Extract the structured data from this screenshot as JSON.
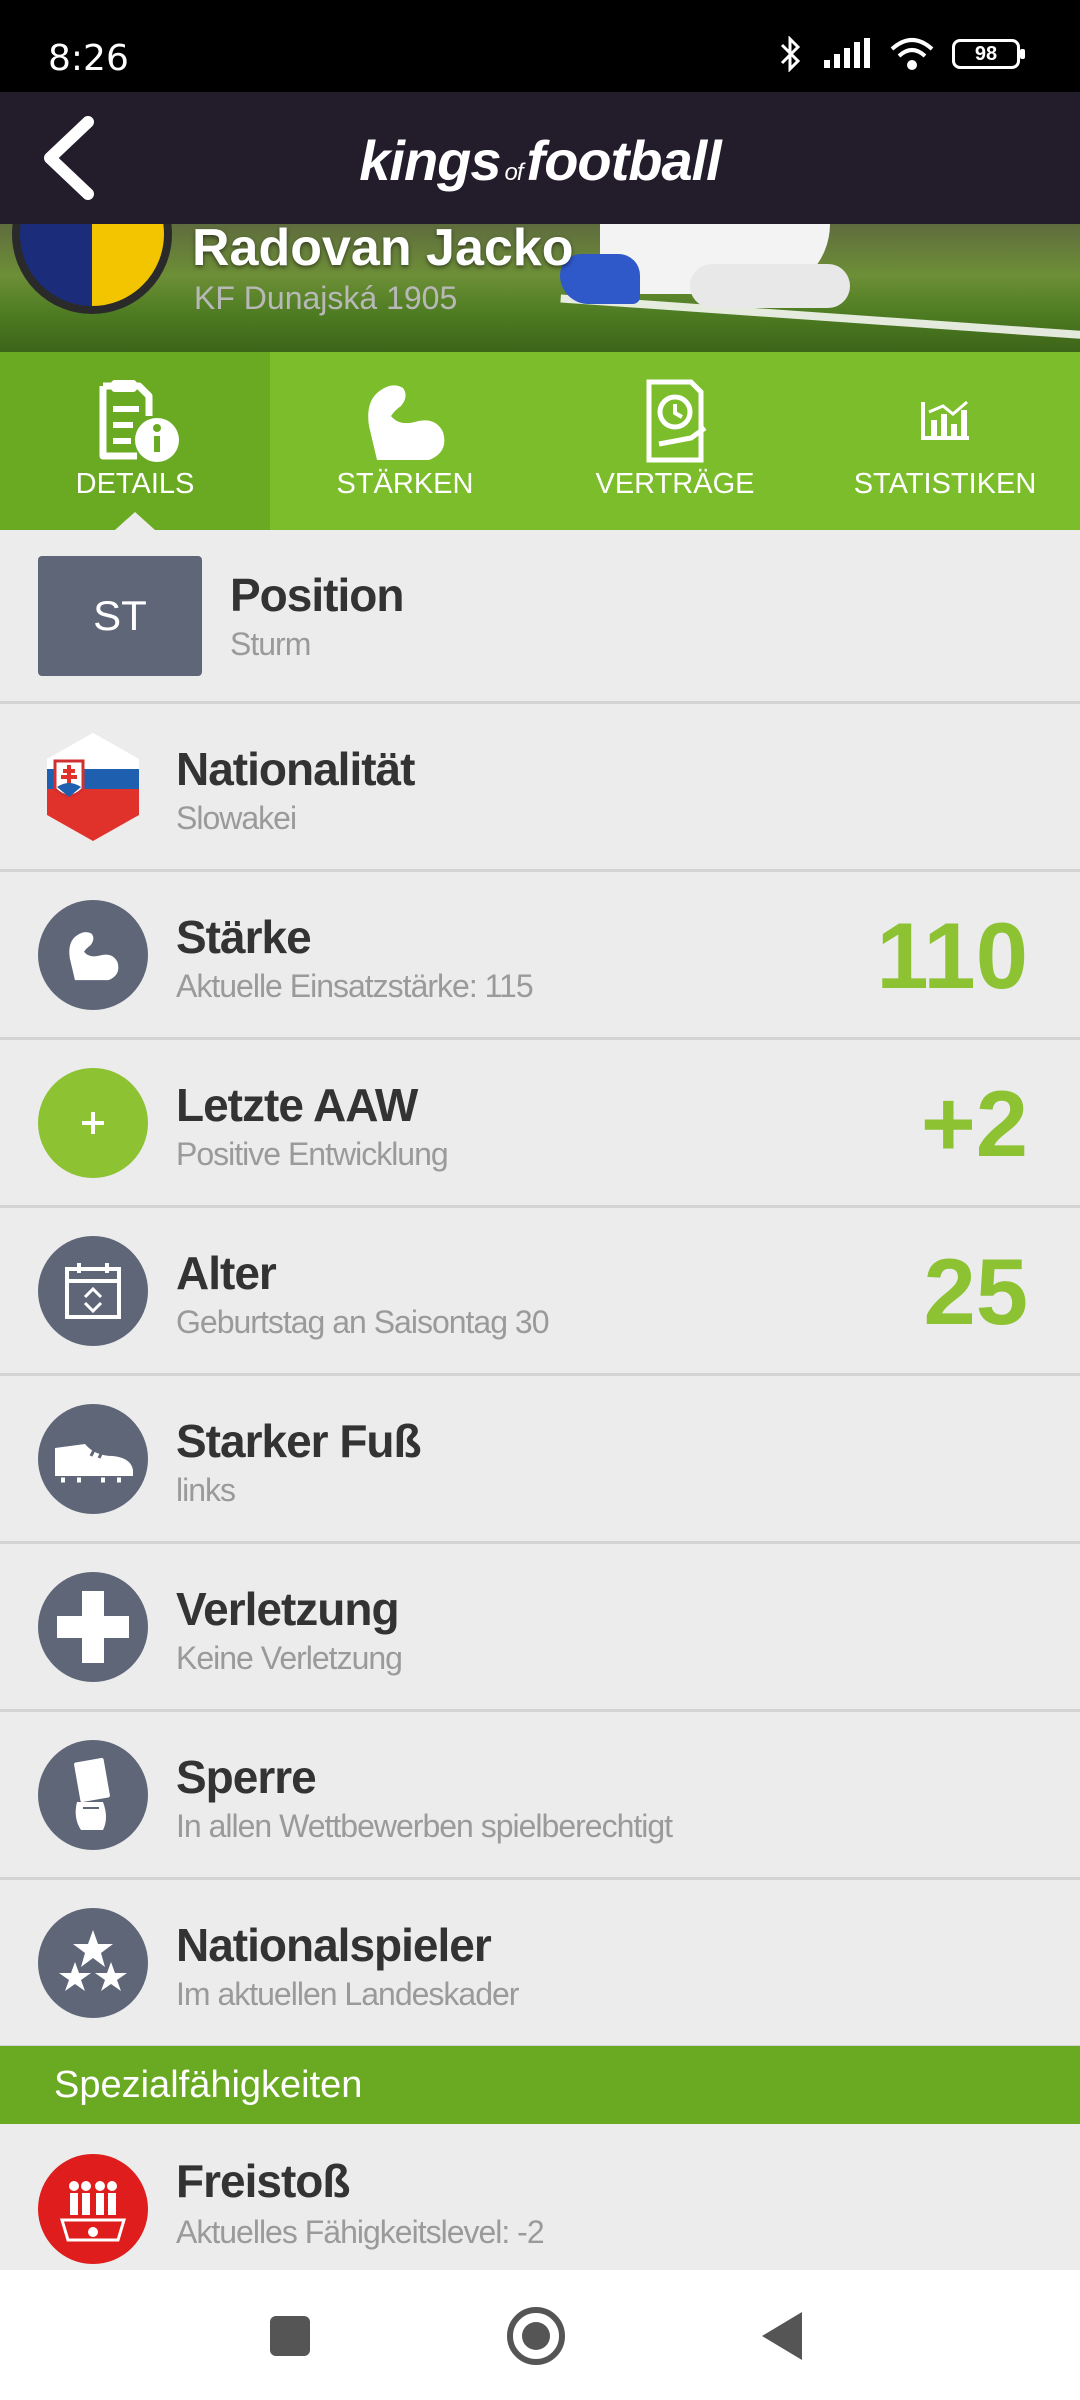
{
  "status_bar": {
    "time": "8:26",
    "battery": "98"
  },
  "app": {
    "brand_part1": "kings",
    "brand_of": "of",
    "brand_part2": "football"
  },
  "player": {
    "name": "Radovan Jacko",
    "club": "KF Dunajská 1905"
  },
  "tabs": [
    {
      "label": "DETAILS",
      "icon": "document-info-icon",
      "active": true
    },
    {
      "label": "STÄRKEN",
      "icon": "bicep-icon",
      "active": false
    },
    {
      "label": "VERTRÄGE",
      "icon": "contract-clock-icon",
      "active": false
    },
    {
      "label": "STATISTIKEN",
      "icon": "bar-chart-icon",
      "active": false
    }
  ],
  "details": {
    "position": {
      "badge": "ST",
      "title": "Position",
      "sub": "Sturm"
    },
    "nationality": {
      "title": "Nationalität",
      "sub": "Slowakei",
      "icon": "slovakia-flag-icon"
    },
    "strength": {
      "title": "Stärke",
      "sub": "Aktuelle Einsatzstärke: 115",
      "value": "110",
      "icon": "bicep-icon"
    },
    "last_aaw": {
      "title": "Letzte AAW",
      "sub": "Positive Entwicklung",
      "value": "+2",
      "icon": "plus-icon"
    },
    "age": {
      "title": "Alter",
      "sub": "Geburtstag an Saisontag 30",
      "value": "25",
      "icon": "calendar-icon"
    },
    "foot": {
      "title": "Starker Fuß",
      "sub": "links",
      "icon": "boot-icon"
    },
    "injury": {
      "title": "Verletzung",
      "sub": "Keine Verletzung",
      "icon": "cross-icon"
    },
    "suspension": {
      "title": "Sperre",
      "sub": "In allen Wettbewerben spielberechtigt",
      "icon": "card-hand-icon"
    },
    "national": {
      "title": "Nationalspieler",
      "sub": "Im aktuellen Landeskader",
      "icon": "stars-icon"
    }
  },
  "special": {
    "section_title": "Spezialfähigkeiten",
    "free_kick": {
      "title": "Freistoß",
      "sub": "Aktuelles Fähigkeitslevel: -2",
      "icon": "freekick-wall-icon"
    }
  },
  "colors": {
    "accent": "#7cbd2c",
    "value_green": "#8dc233",
    "icon_bg": "#5e6678",
    "appbar": "#221c2b",
    "special_red": "#e01d1d"
  }
}
